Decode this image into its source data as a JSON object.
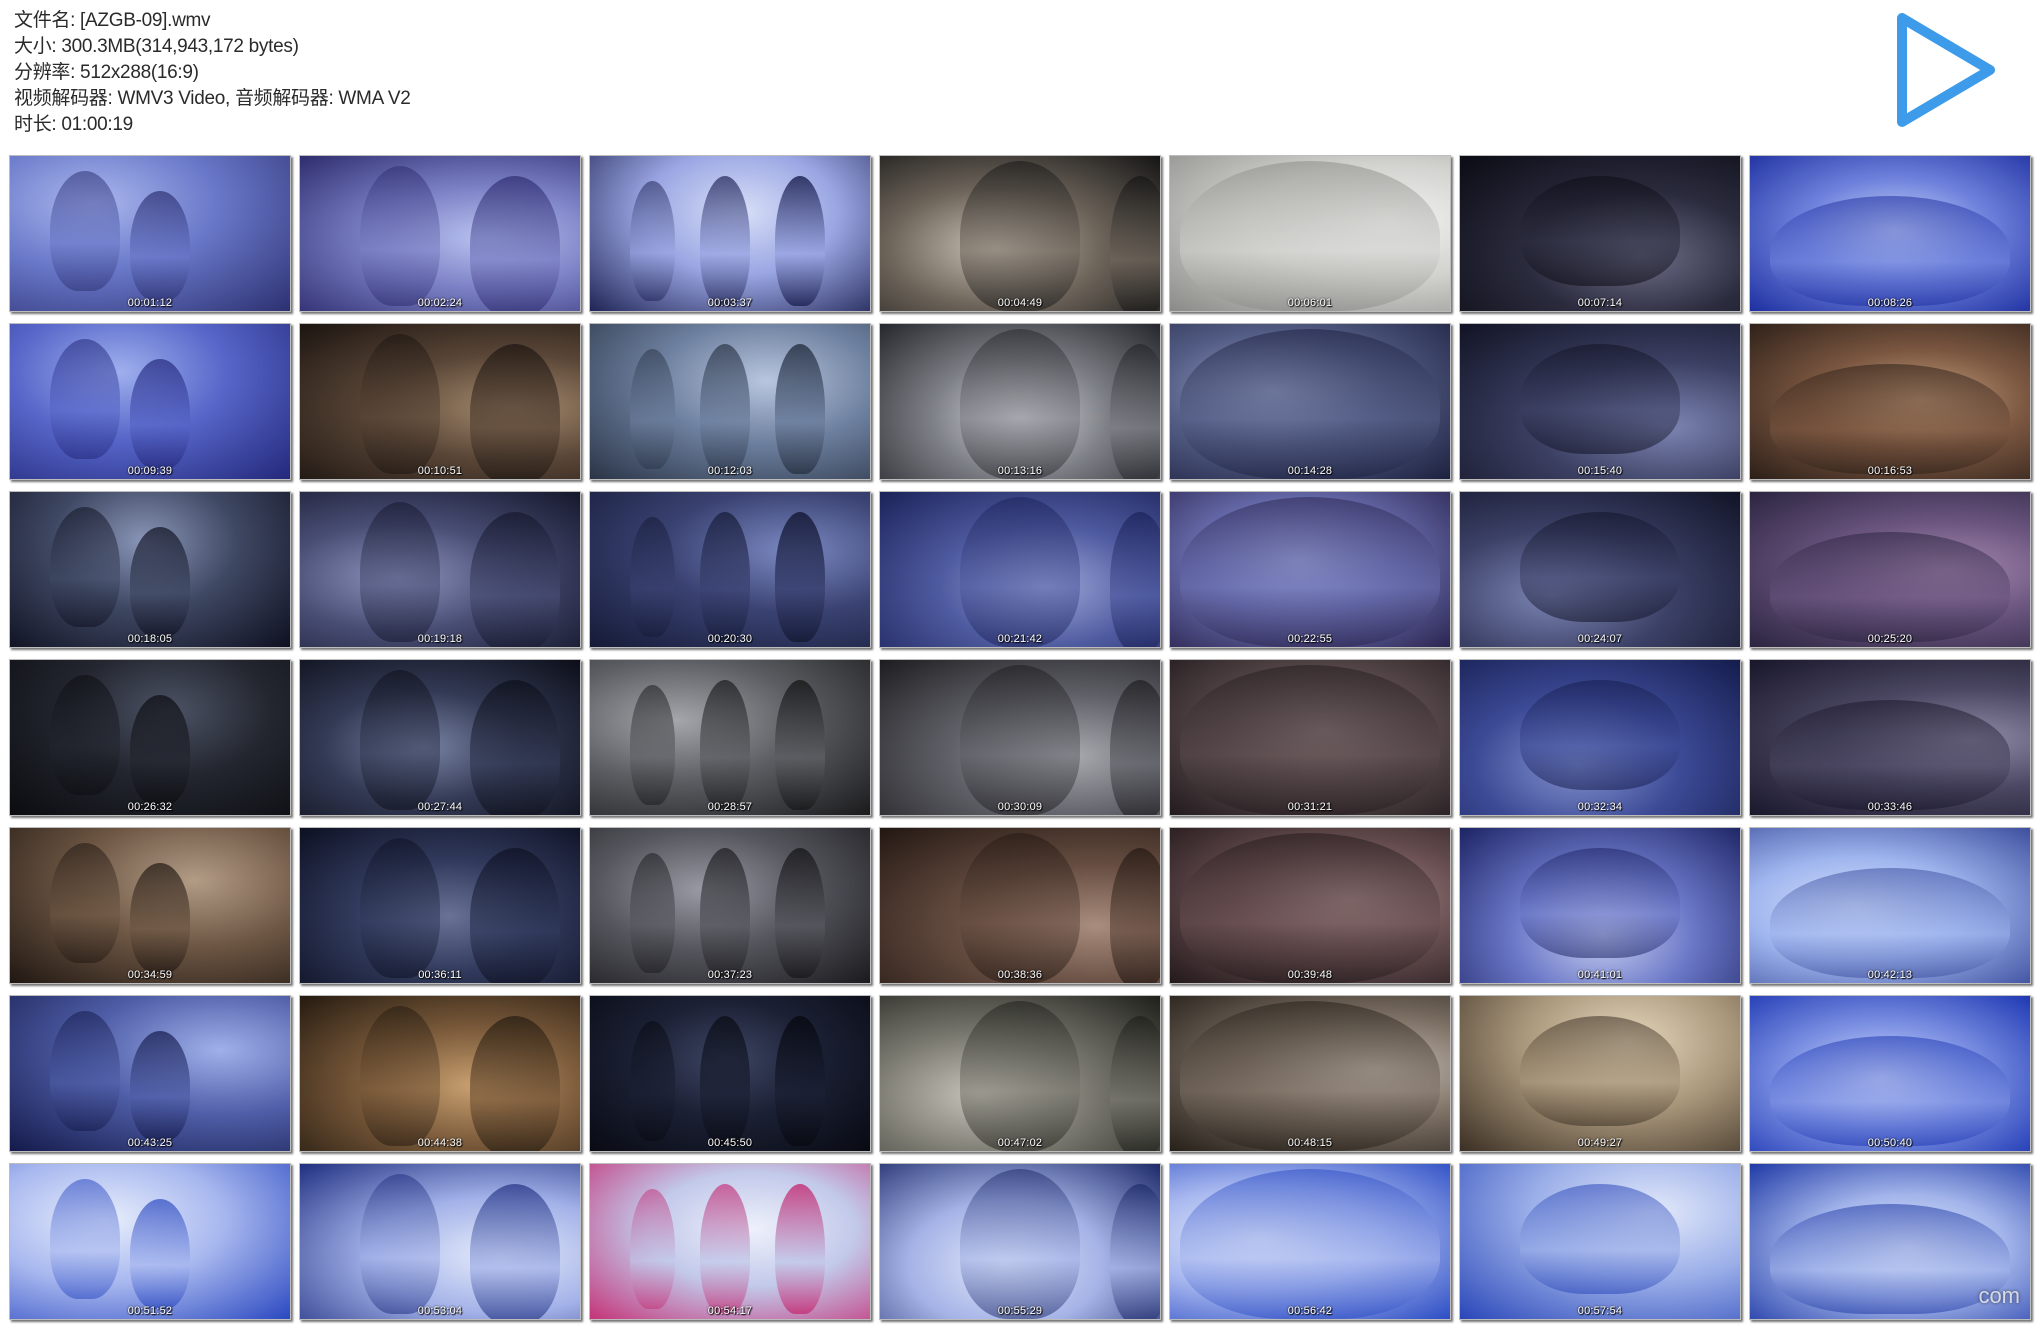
{
  "info": {
    "filename": "文件名: [AZGB-09].wmv",
    "size": "大小: 300.3MB(314,943,172 bytes)",
    "resolution": "分辨率: 512x288(16:9)",
    "codecs": "视频解码器: WMV3 Video, 音频解码器: WMA V2",
    "duration": "时长: 01:00:19"
  },
  "play_icon": {
    "name": "play-icon",
    "color": "#3d9be9"
  },
  "watermark": "com",
  "thumbnails": [
    {
      "time": "00:01:12",
      "palette": [
        "#aab7ee",
        "#6877c8",
        "#2c3070"
      ]
    },
    {
      "time": "00:02:24",
      "palette": [
        "#b9c3f0",
        "#7a7fc4",
        "#2d2c6e"
      ]
    },
    {
      "time": "00:03:37",
      "palette": [
        "#d8dff7",
        "#9aa6e3",
        "#1f2454"
      ]
    },
    {
      "time": "00:04:49",
      "palette": [
        "#c9c2b6",
        "#6e655b",
        "#151515"
      ]
    },
    {
      "time": "00:06:01",
      "palette": [
        "#f2f2f0",
        "#d2d2cf",
        "#8a8a86"
      ]
    },
    {
      "time": "00:07:14",
      "palette": [
        "#6d6e88",
        "#2a2b3d",
        "#0b0b14"
      ]
    },
    {
      "time": "00:08:26",
      "palette": [
        "#cfd8f6",
        "#6f83dd",
        "#1e2fa0"
      ]
    },
    {
      "time": "00:09:39",
      "palette": [
        "#9fb0ee",
        "#5665c8",
        "#23287a"
      ]
    },
    {
      "time": "00:10:51",
      "palette": [
        "#a58b6e",
        "#5a4637",
        "#1b1410"
      ]
    },
    {
      "time": "00:12:03",
      "palette": [
        "#b9c6df",
        "#6c7f9e",
        "#2a3446"
      ]
    },
    {
      "time": "00:13:16",
      "palette": [
        "#d7d9df",
        "#7d7f86",
        "#26272c"
      ]
    },
    {
      "time": "00:14:28",
      "palette": [
        "#9ea8cc",
        "#545e86",
        "#1d2140"
      ]
    },
    {
      "time": "00:15:40",
      "palette": [
        "#7d85b3",
        "#3b3f62",
        "#111223"
      ]
    },
    {
      "time": "00:16:53",
      "palette": [
        "#c7a17f",
        "#7a5640",
        "#2c1f18"
      ]
    },
    {
      "time": "00:18:05",
      "palette": [
        "#8a96b8",
        "#3f4863",
        "#0e1020"
      ]
    },
    {
      "time": "00:19:18",
      "palette": [
        "#8d94bd",
        "#484d74",
        "#15172b"
      ]
    },
    {
      "time": "00:20:30",
      "palette": [
        "#7b89c2",
        "#3a4272",
        "#151a36"
      ]
    },
    {
      "time": "00:21:42",
      "palette": [
        "#9ea7d8",
        "#4f5ba0",
        "#1b2259"
      ]
    },
    {
      "time": "00:22:55",
      "palette": [
        "#a9b2e4",
        "#6a6fb0",
        "#2b2550"
      ]
    },
    {
      "time": "00:24:07",
      "palette": [
        "#7c85b4",
        "#3b4066",
        "#111326"
      ]
    },
    {
      "time": "00:25:20",
      "palette": [
        "#a88ab0",
        "#69547e",
        "#2b2440"
      ]
    },
    {
      "time": "00:26:32",
      "palette": [
        "#4d5366",
        "#23262f",
        "#0b0c10"
      ]
    },
    {
      "time": "00:27:44",
      "palette": [
        "#7882a3",
        "#333a55",
        "#0c0e18"
      ]
    },
    {
      "time": "00:28:57",
      "palette": [
        "#a4a6ab",
        "#5c5e63",
        "#1a1a1c"
      ]
    },
    {
      "time": "00:30:09",
      "palette": [
        "#a9aab0",
        "#606168",
        "#1d1c20"
      ]
    },
    {
      "time": "00:31:21",
      "palette": [
        "#8a7a7c",
        "#5a4b4d",
        "#231b1e"
      ]
    },
    {
      "time": "00:32:34",
      "palette": [
        "#8593cf",
        "#3c4a96",
        "#141c4c"
      ]
    },
    {
      "time": "00:33:46",
      "palette": [
        "#8f8aa5",
        "#4b4762",
        "#18162a"
      ]
    },
    {
      "time": "00:34:59",
      "palette": [
        "#b39c86",
        "#6e5744",
        "#201712"
      ]
    },
    {
      "time": "00:36:11",
      "palette": [
        "#6a7396",
        "#313a5c",
        "#0d1022"
      ]
    },
    {
      "time": "00:37:23",
      "palette": [
        "#9a9aa4",
        "#56565e",
        "#1a1a1e"
      ]
    },
    {
      "time": "00:38:36",
      "palette": [
        "#a98d7e",
        "#654c40",
        "#221712"
      ]
    },
    {
      "time": "00:39:48",
      "palette": [
        "#a98f90",
        "#6a5052",
        "#23191b"
      ]
    },
    {
      "time": "00:41:01",
      "palette": [
        "#c8cff0",
        "#6a77c7",
        "#1d2464"
      ]
    },
    {
      "time": "00:42:13",
      "palette": [
        "#d6e2fb",
        "#9fb5ee",
        "#3d4f9e"
      ]
    },
    {
      "time": "00:43:25",
      "palette": [
        "#9fb0ea",
        "#4f5ea8",
        "#141a4a"
      ]
    },
    {
      "time": "00:44:38",
      "palette": [
        "#c9a070",
        "#7a5a3a",
        "#241a10"
      ]
    },
    {
      "time": "00:45:50",
      "palette": [
        "#3e4664",
        "#1b2034",
        "#080a12"
      ]
    },
    {
      "time": "00:47:02",
      "palette": [
        "#c7c5ba",
        "#77766d",
        "#1f1f1b"
      ]
    },
    {
      "time": "00:48:15",
      "palette": [
        "#c9c0b6",
        "#7c6f64",
        "#252019"
      ]
    },
    {
      "time": "00:49:27",
      "palette": [
        "#e6d7bc",
        "#a8967a",
        "#3b2f24"
      ]
    },
    {
      "time": "00:50:40",
      "palette": [
        "#dbe3fb",
        "#7f93e4",
        "#1e38b3"
      ]
    },
    {
      "time": "00:51:52",
      "palette": [
        "#e8eefc",
        "#a8b8ef",
        "#2a48c0"
      ]
    },
    {
      "time": "00:53:04",
      "palette": [
        "#e6ecfb",
        "#a2b1e8",
        "#1f2f80"
      ]
    },
    {
      "time": "00:54:17",
      "palette": [
        "#eef1fb",
        "#c2c9ea",
        "#c43378"
      ]
    },
    {
      "time": "00:55:29",
      "palette": [
        "#e4eafb",
        "#a4b2e6",
        "#1d2a6a"
      ]
    },
    {
      "time": "00:56:42",
      "palette": [
        "#e7edfb",
        "#a8b8ef",
        "#2c4dc4"
      ]
    },
    {
      "time": "00:57:54",
      "palette": [
        "#e4eafb",
        "#9aaee8",
        "#2946b8"
      ]
    },
    {
      "time": "",
      "palette": [
        "#e6ecfb",
        "#a2b4ea",
        "#1f3aa6"
      ]
    }
  ]
}
